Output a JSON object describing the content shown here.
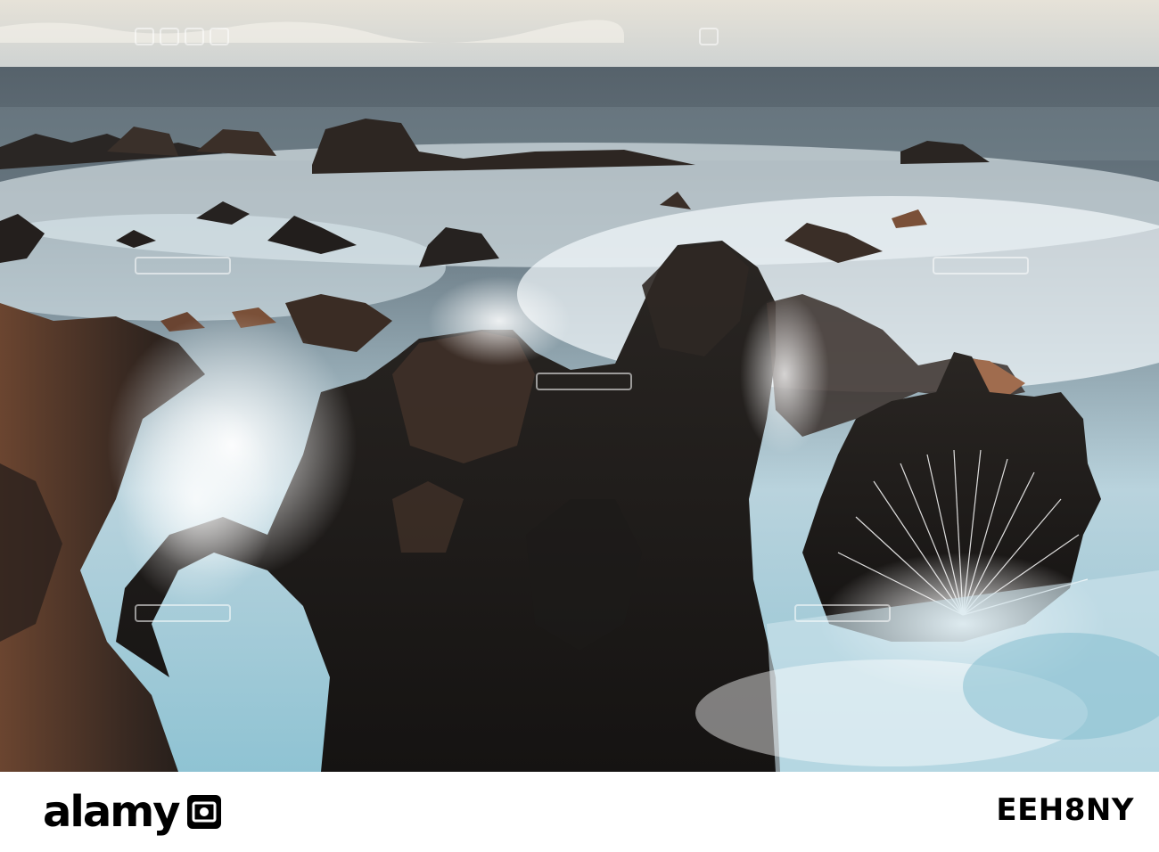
{
  "photo": {
    "subject": "",
    "watermark_text": "alamy"
  },
  "footer": {
    "brand": "alamy",
    "brand_icon": "alamy-logo-icon",
    "image_id": "EEH8NY"
  }
}
